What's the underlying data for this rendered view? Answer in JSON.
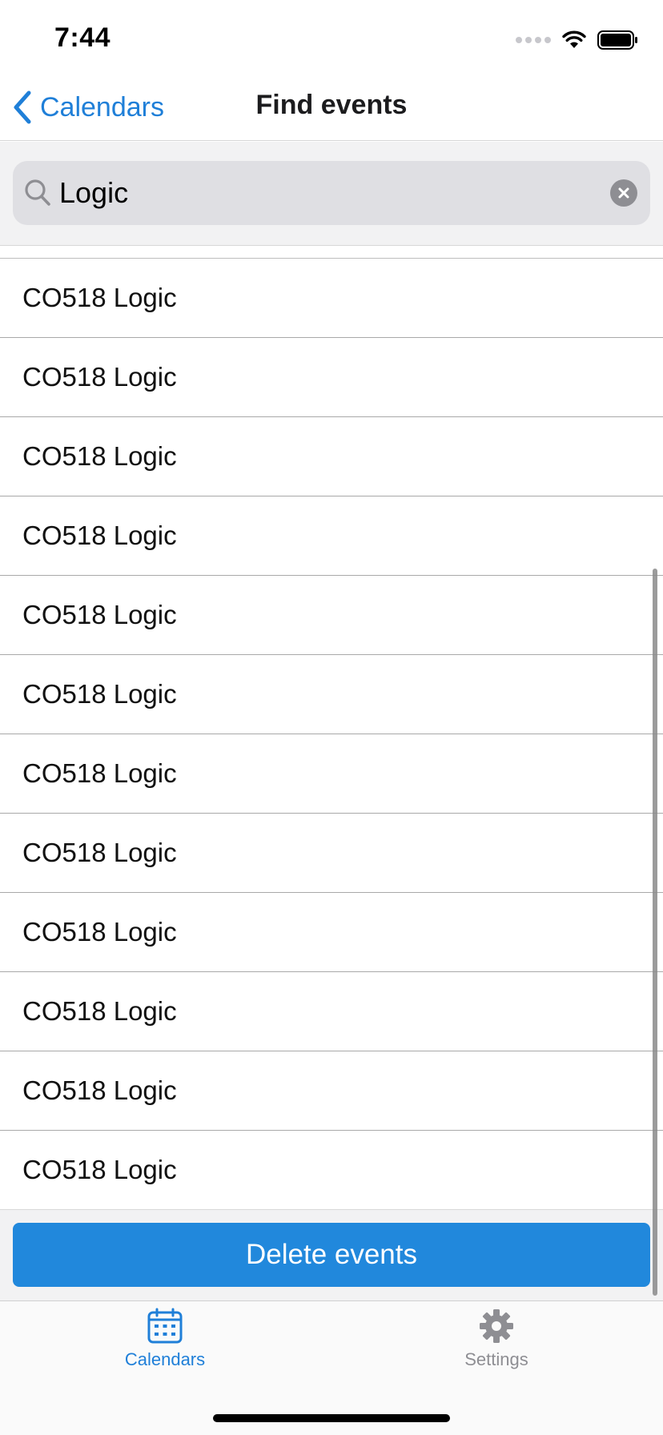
{
  "status_bar": {
    "time": "7:44"
  },
  "nav": {
    "back_label": "Calendars",
    "title": "Find events"
  },
  "search": {
    "value": "Logic",
    "placeholder": ""
  },
  "events": [
    {
      "title": "CO518 Logic"
    },
    {
      "title": "CO518 Logic"
    },
    {
      "title": "CO518 Logic"
    },
    {
      "title": "CO518 Logic"
    },
    {
      "title": "CO518 Logic"
    },
    {
      "title": "CO518 Logic"
    },
    {
      "title": "CO518 Logic"
    },
    {
      "title": "CO518 Logic"
    },
    {
      "title": "CO518 Logic"
    },
    {
      "title": "CO518 Logic"
    },
    {
      "title": "CO518 Logic"
    },
    {
      "title": "CO518 Logic"
    }
  ],
  "actions": {
    "delete_label": "Delete events"
  },
  "tabs": [
    {
      "label": "Calendars",
      "icon": "calendar-icon",
      "active": true
    },
    {
      "label": "Settings",
      "icon": "gear-icon",
      "active": false
    }
  ],
  "colors": {
    "accent": "#1f7fd8",
    "button": "#2188dc",
    "inactive_tab": "#8e8e93"
  }
}
